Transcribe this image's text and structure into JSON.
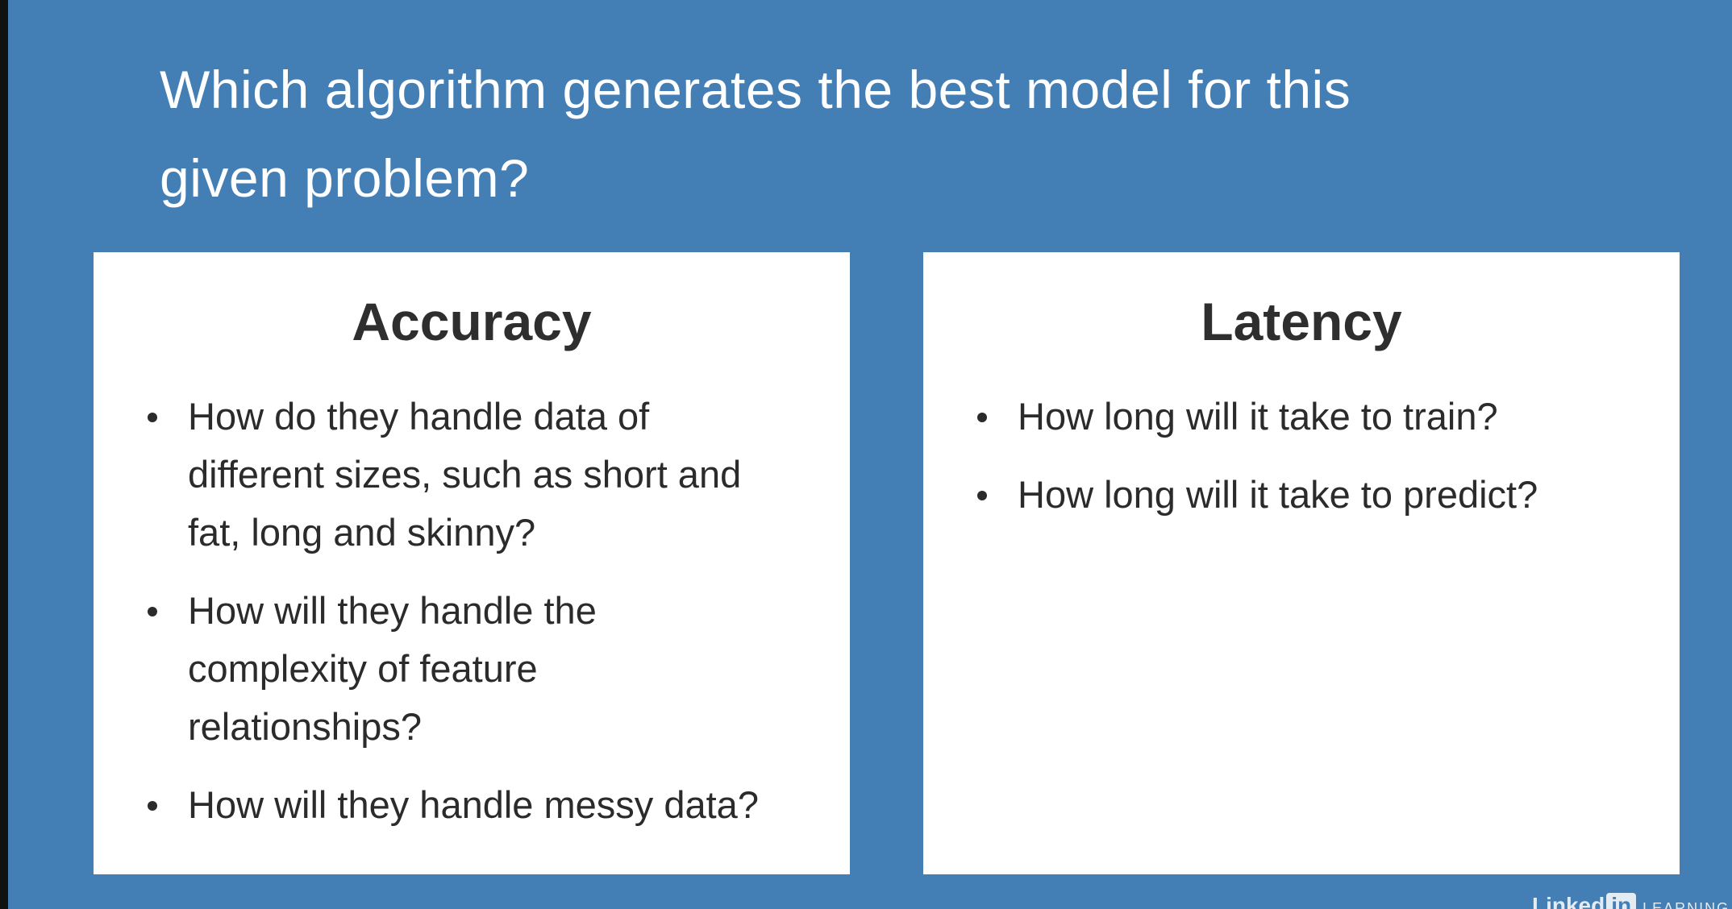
{
  "slide": {
    "title_lines": [
      "Which algorithm generates the best model for this",
      "given problem?"
    ],
    "accuracy": {
      "heading": "Accuracy",
      "bullets": [
        [
          "How do they handle data of",
          "different sizes, such as short and",
          "fat, long and skinny?"
        ],
        [
          "How will they handle the",
          "complexity of feature",
          "relationships?"
        ],
        [
          "How will they handle messy data?"
        ]
      ]
    },
    "latency": {
      "heading": "Latency",
      "bullets": [
        [
          "How long will it take to train?"
        ],
        [
          "How long will it take to predict?"
        ]
      ]
    }
  },
  "logo": {
    "name": "Linked",
    "in": "in",
    "suffix": "LEARNING"
  },
  "colors": {
    "background": "#437eb4",
    "card": "#ffffff",
    "text_dark": "#2b2b2b",
    "title": "#ffffff"
  }
}
